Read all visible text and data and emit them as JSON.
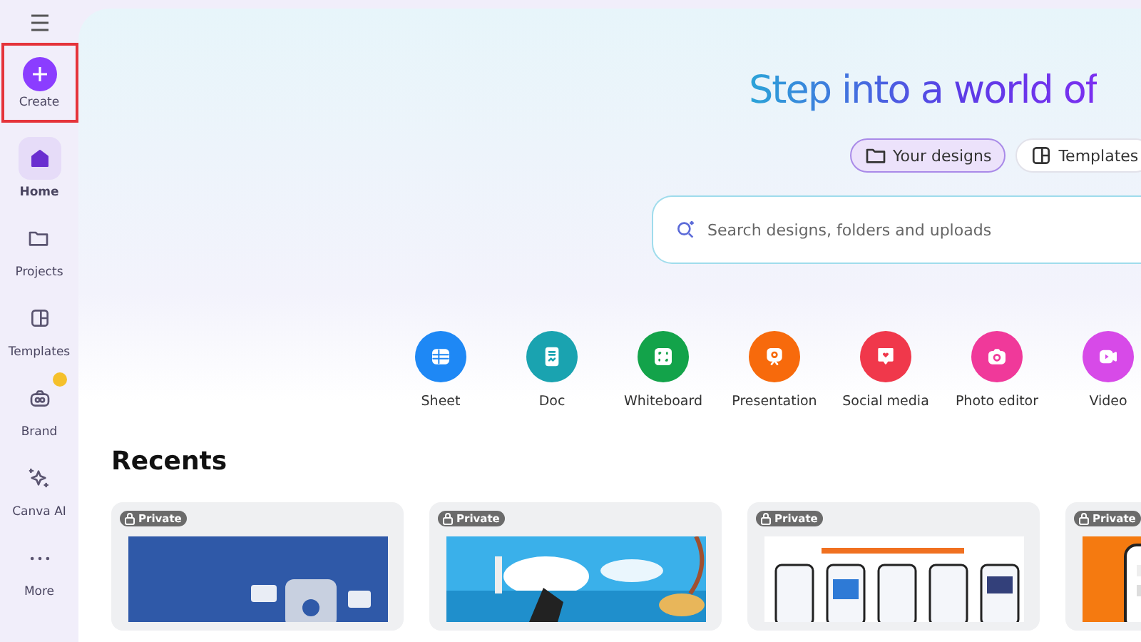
{
  "sidebar": {
    "create": {
      "label": "Create",
      "highlighted": true
    },
    "items": [
      {
        "label": "Home",
        "selected": true,
        "premium": false
      },
      {
        "label": "Projects",
        "selected": false,
        "premium": false
      },
      {
        "label": "Templates",
        "selected": false,
        "premium": false
      },
      {
        "label": "Brand",
        "selected": false,
        "premium": true
      },
      {
        "label": "Canva AI",
        "selected": false,
        "premium": false
      },
      {
        "label": "More",
        "selected": false,
        "premium": false
      }
    ]
  },
  "hero": {
    "title": "Step into a world of",
    "chips": [
      {
        "label": "Your designs",
        "selected": true
      },
      {
        "label": "Templates",
        "selected": false
      }
    ],
    "search": {
      "placeholder": "Search designs, folders and uploads"
    }
  },
  "categories": [
    {
      "label": "Sheet",
      "color": "#1e88f5"
    },
    {
      "label": "Doc",
      "color": "#1aa3b0"
    },
    {
      "label": "Whiteboard",
      "color": "#13a34a"
    },
    {
      "label": "Presentation",
      "color": "#f76a0c"
    },
    {
      "label": "Social media",
      "color": "#f0384b"
    },
    {
      "label": "Photo editor",
      "color": "#f0399a"
    },
    {
      "label": "Video",
      "color": "#d74ae8"
    }
  ],
  "recents": {
    "title": "Recents",
    "cards": [
      {
        "badge": "Private",
        "kind": "picture"
      },
      {
        "badge": "Private",
        "kind": "picture"
      },
      {
        "badge": "Private",
        "kind": "picture"
      },
      {
        "badge": "Private",
        "kind": "picture"
      }
    ]
  }
}
